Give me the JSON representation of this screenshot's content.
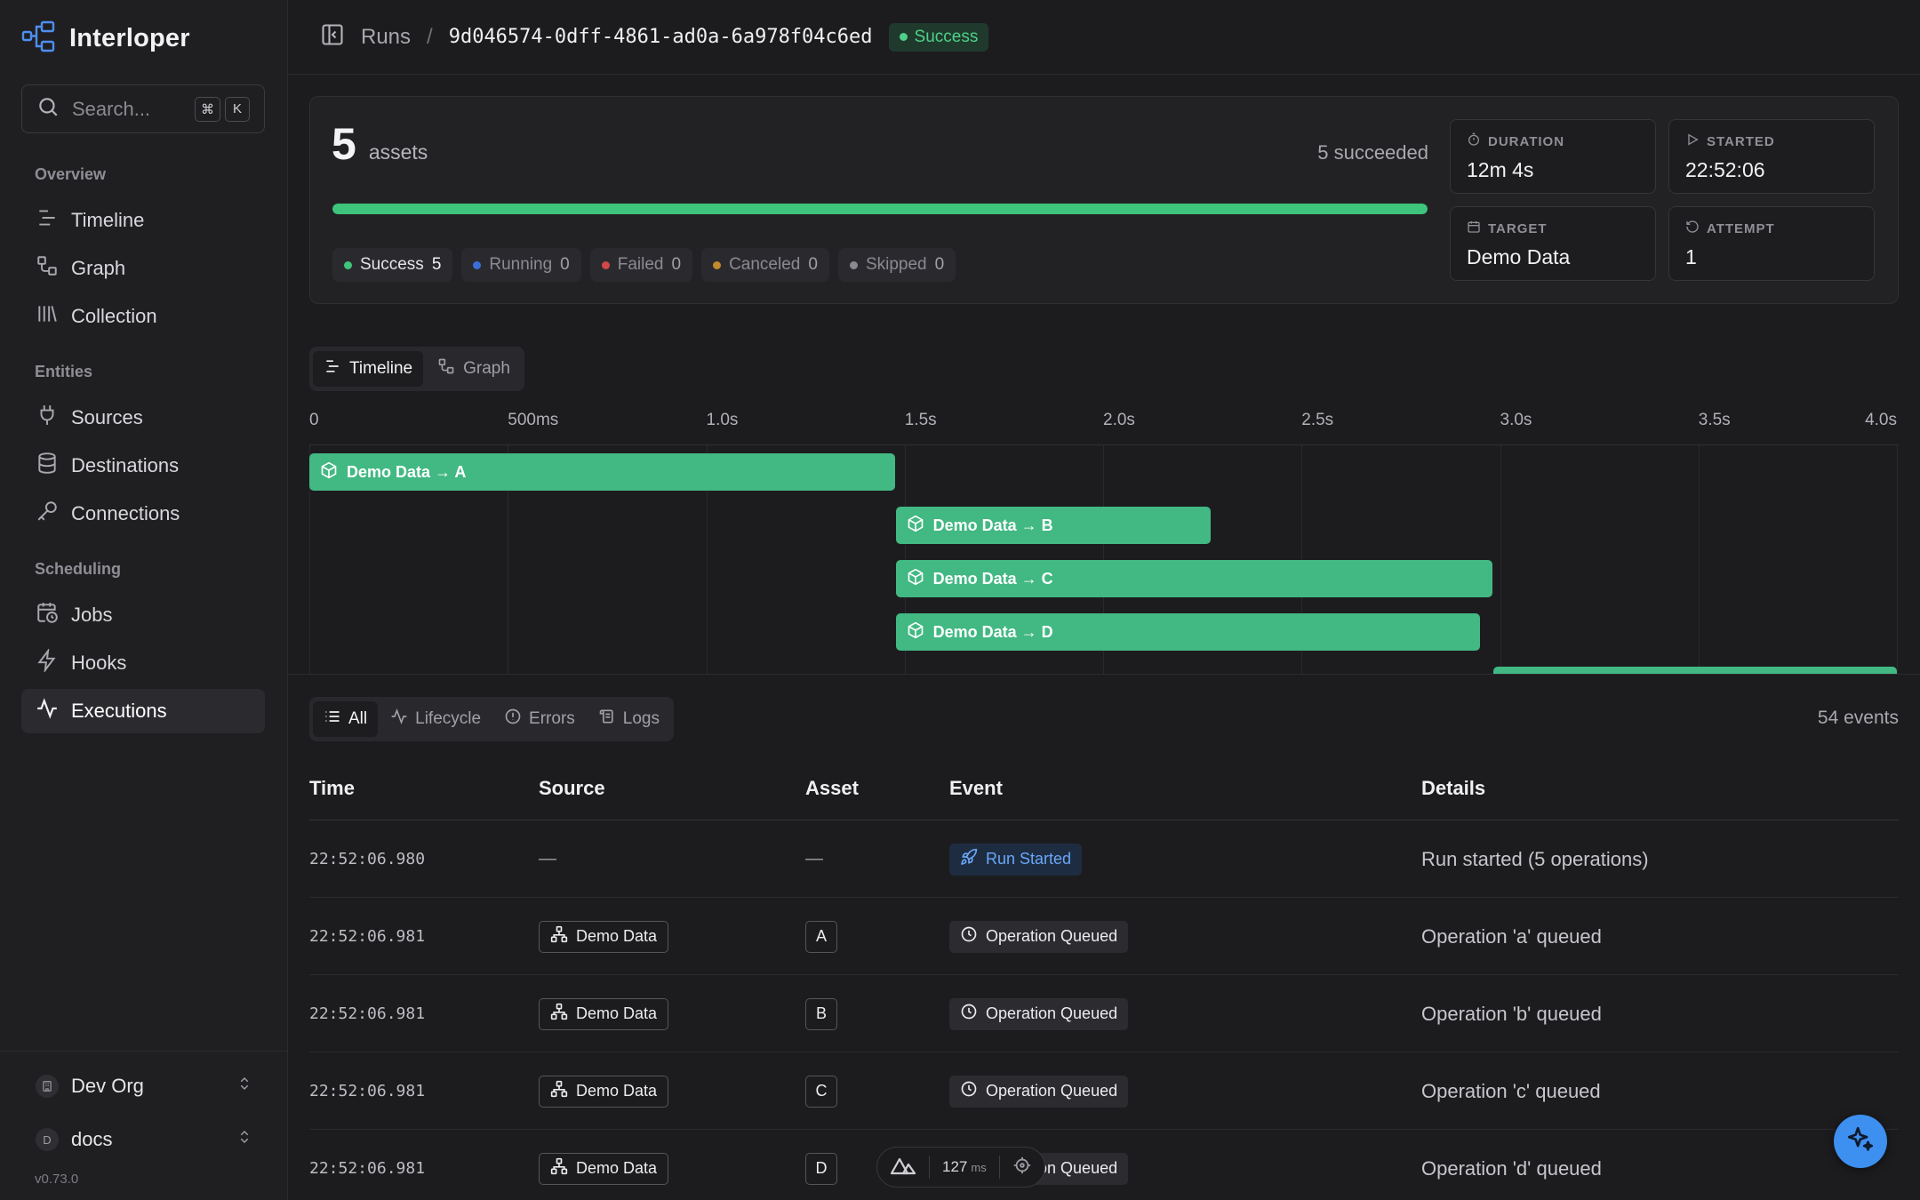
{
  "app": {
    "name": "Interloper",
    "version": "v0.73.0"
  },
  "search": {
    "placeholder": "Search...",
    "shortcut_mod": "⌘",
    "shortcut_key": "K"
  },
  "sidebar": {
    "sections": [
      {
        "label": "Overview",
        "items": [
          {
            "label": "Timeline",
            "icon": "timeline-icon"
          },
          {
            "label": "Graph",
            "icon": "graph-icon"
          },
          {
            "label": "Collection",
            "icon": "library-icon"
          }
        ]
      },
      {
        "label": "Entities",
        "items": [
          {
            "label": "Sources",
            "icon": "plug-icon"
          },
          {
            "label": "Destinations",
            "icon": "database-icon"
          },
          {
            "label": "Connections",
            "icon": "key-icon"
          }
        ]
      },
      {
        "label": "Scheduling",
        "items": [
          {
            "label": "Jobs",
            "icon": "calendar-clock-icon"
          },
          {
            "label": "Hooks",
            "icon": "bolt-icon"
          },
          {
            "label": "Executions",
            "icon": "activity-icon"
          }
        ]
      }
    ],
    "active": "Executions",
    "org": {
      "name": "Dev Org"
    },
    "workspace": {
      "initial": "D",
      "name": "docs"
    }
  },
  "header": {
    "crumb": "Runs",
    "separator": "/",
    "run_id": "9d046574-0dff-4861-ad0a-6a978f04c6ed",
    "status": "Success",
    "status_color": "#4fd08a"
  },
  "summary": {
    "asset_count": "5",
    "asset_label": "assets",
    "succeeded_text": "5 succeeded",
    "progress": 1.0,
    "chips": [
      {
        "label": "Success",
        "count": "5",
        "color": "#3fc47c",
        "active": true
      },
      {
        "label": "Running",
        "count": "0",
        "color": "#3b6fd8",
        "active": false
      },
      {
        "label": "Failed",
        "count": "0",
        "color": "#d04848",
        "active": false
      },
      {
        "label": "Canceled",
        "count": "0",
        "color": "#c28a2c",
        "active": false
      },
      {
        "label": "Skipped",
        "count": "0",
        "color": "#8a8a90",
        "active": false
      }
    ],
    "stats": {
      "duration": {
        "label": "DURATION",
        "value": "12m 4s"
      },
      "started": {
        "label": "STARTED",
        "value": "22:52:06"
      },
      "target": {
        "label": "TARGET",
        "value": "Demo Data"
      },
      "attempt": {
        "label": "ATTEMPT",
        "value": "1"
      }
    }
  },
  "view_toggle": {
    "options": [
      "Timeline",
      "Graph"
    ],
    "selected": "Timeline"
  },
  "timeline": {
    "ticks": [
      "0",
      "500ms",
      "1.0s",
      "1.5s",
      "2.0s",
      "2.5s",
      "3.0s",
      "3.5s",
      "4.0s"
    ],
    "tick_seconds": [
      0,
      0.5,
      1.0,
      1.5,
      2.0,
      2.5,
      3.0,
      3.5,
      4.0
    ],
    "bars": [
      {
        "label": "Demo Data → A",
        "start": 0.0,
        "end": 1.475
      },
      {
        "label": "Demo Data → B",
        "start": 1.475,
        "end": 2.27
      },
      {
        "label": "Demo Data → C",
        "start": 1.475,
        "end": 2.98
      },
      {
        "label": "Demo Data → D",
        "start": 1.475,
        "end": 2.95
      },
      {
        "label": "",
        "start": 2.98,
        "end": 4.0
      }
    ],
    "bar_color": "#42b883"
  },
  "events": {
    "filters": [
      "All",
      "Lifecycle",
      "Errors",
      "Logs"
    ],
    "selected": "All",
    "count_text": "54 events",
    "columns": [
      "Time",
      "Source",
      "Asset",
      "Event",
      "Details"
    ],
    "rows": [
      {
        "time": "22:52:06.980",
        "source": "—",
        "asset": "—",
        "event": "Run Started",
        "event_kind": "run",
        "details": "Run started (5 operations)"
      },
      {
        "time": "22:52:06.981",
        "source": "Demo Data",
        "asset": "A",
        "event": "Operation Queued",
        "event_kind": "queued",
        "details": "Operation 'a' queued"
      },
      {
        "time": "22:52:06.981",
        "source": "Demo Data",
        "asset": "B",
        "event": "Operation Queued",
        "event_kind": "queued",
        "details": "Operation 'b' queued"
      },
      {
        "time": "22:52:06.981",
        "source": "Demo Data",
        "asset": "C",
        "event": "Operation Queued",
        "event_kind": "queued",
        "details": "Operation 'c' queued"
      },
      {
        "time": "22:52:06.981",
        "source": "Demo Data",
        "asset": "D",
        "event": "Operation Queued",
        "event_kind": "queued",
        "details": "Operation 'd' queued"
      }
    ]
  },
  "perf_widget": {
    "value": "127",
    "unit": "ms"
  }
}
